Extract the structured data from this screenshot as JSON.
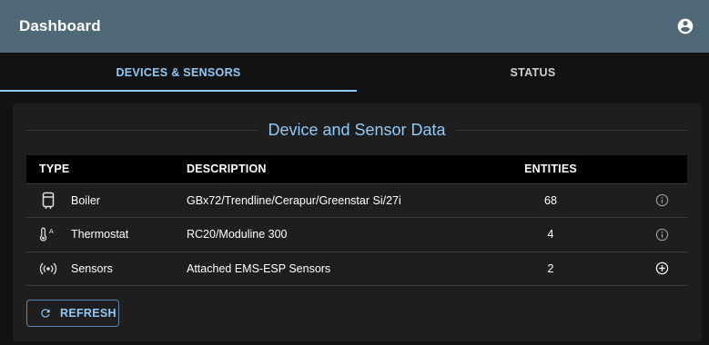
{
  "appbar": {
    "title": "Dashboard",
    "account_icon": "account-circle-icon"
  },
  "tabs": [
    {
      "label": "DEVICES & SENSORS",
      "active": true
    },
    {
      "label": "STATUS",
      "active": false
    }
  ],
  "section": {
    "title": "Device and Sensor Data"
  },
  "table": {
    "headers": {
      "type": "TYPE",
      "description": "DESCRIPTION",
      "entities": "ENTITIES"
    },
    "rows": [
      {
        "icon": "boiler-icon",
        "type": "Boiler",
        "description": "GBx72/Trendline/Cerapur/Greenstar Si/27i",
        "entities": "68",
        "action_icon": "info-icon"
      },
      {
        "icon": "thermostat-icon",
        "type": "Thermostat",
        "description": "RC20/Moduline 300",
        "entities": "4",
        "action_icon": "info-icon"
      },
      {
        "icon": "sensors-icon",
        "type": "Sensors",
        "description": "Attached EMS-ESP Sensors",
        "entities": "2",
        "action_icon": "add-circle-icon"
      }
    ]
  },
  "refresh_button": {
    "label": "REFRESH",
    "icon": "refresh-icon"
  },
  "colors": {
    "appbar": "#4f6878",
    "accent": "#90caf9",
    "background": "#121212",
    "panel": "#1e1e1e",
    "header_row": "#000000"
  }
}
